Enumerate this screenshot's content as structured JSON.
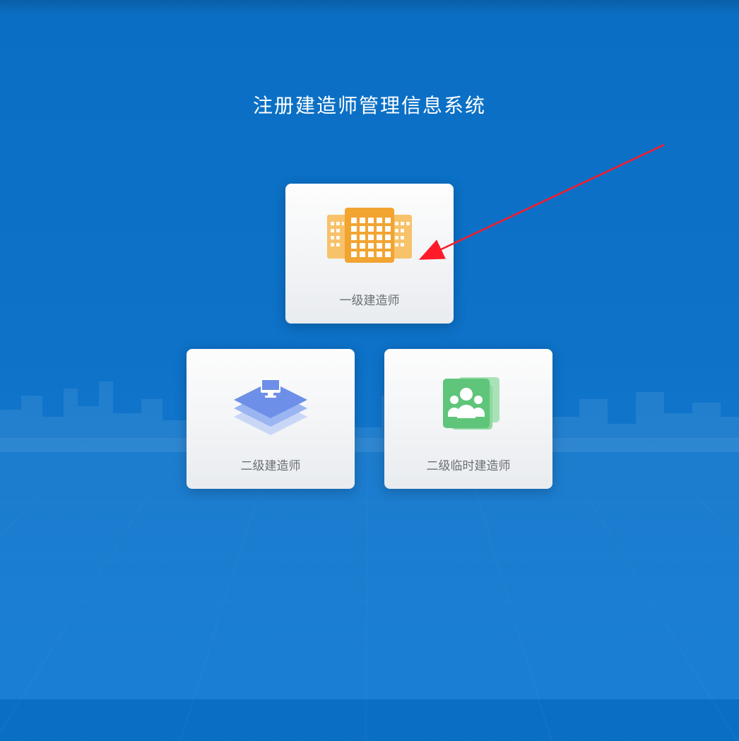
{
  "page": {
    "title": "注册建造师管理信息系统"
  },
  "cards": {
    "level1": {
      "label": "一级建造师"
    },
    "level2": {
      "label": "二级建造师"
    },
    "level2temp": {
      "label": "二级临时建造师"
    }
  },
  "colors": {
    "bg": "#0d72c8",
    "card1_accent": "#f2a431",
    "card2_accent": "#7a9cf2",
    "card3_accent": "#5fc57a",
    "label": "#6a6e73"
  }
}
